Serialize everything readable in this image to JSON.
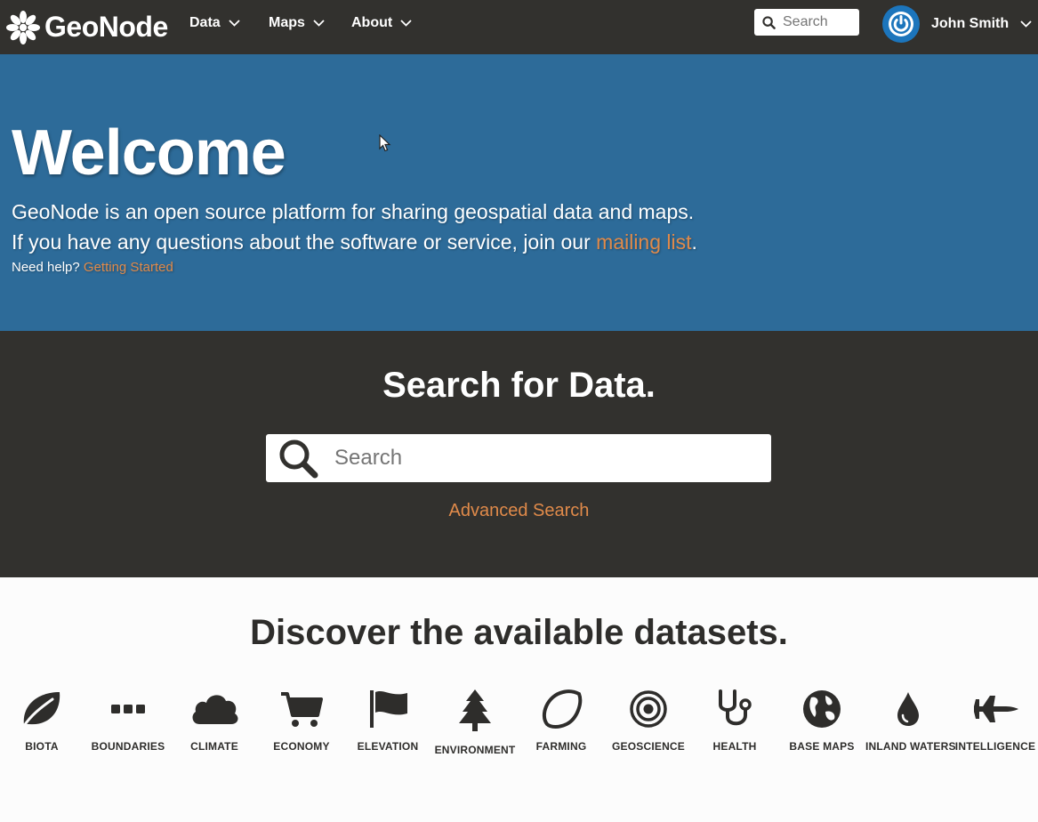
{
  "navbar": {
    "brand": "GeoNode",
    "menu": [
      {
        "label": "Data"
      },
      {
        "label": "Maps"
      },
      {
        "label": "About"
      }
    ],
    "search_placeholder": "Search",
    "user_name": "John Smith"
  },
  "hero": {
    "title": "Welcome",
    "line1": "GeoNode is an open source platform for sharing geospatial data and maps.",
    "line2_prefix": "If you have any questions about the software or service, join our ",
    "mailing_link": "mailing list",
    "line2_suffix": ".",
    "help_prefix": "Need help?",
    "help_link": "Getting Started"
  },
  "search_section": {
    "title": "Search for Data.",
    "placeholder": "Search",
    "advanced": "Advanced Search"
  },
  "discover": {
    "title": "Discover the available datasets.",
    "categories": [
      {
        "label": "BIOTA",
        "icon": "leaf-icon"
      },
      {
        "label": "BOUNDARIES",
        "icon": "dots-icon"
      },
      {
        "label": "CLIMATE",
        "icon": "cloud-icon"
      },
      {
        "label": "ECONOMY",
        "icon": "cart-icon"
      },
      {
        "label": "ELEVATION",
        "icon": "flag-icon"
      },
      {
        "label": "ENVIRONMENT",
        "icon": "tree-icon"
      },
      {
        "label": "FARMING",
        "icon": "lemon-icon"
      },
      {
        "label": "GEOSCIENCE",
        "icon": "target-icon"
      },
      {
        "label": "HEALTH",
        "icon": "stethoscope-icon"
      },
      {
        "label": "BASE MAPS",
        "icon": "globe-icon"
      },
      {
        "label": "INLAND WATERS",
        "icon": "drop-icon"
      },
      {
        "label": "INTELLIGENCE",
        "icon": "jet-icon"
      }
    ]
  },
  "colors": {
    "navbar_bg": "#32312e",
    "hero_bg": "#2d6b99",
    "accent_link": "#e08a4a",
    "avatar_blue": "#1c75bc"
  }
}
